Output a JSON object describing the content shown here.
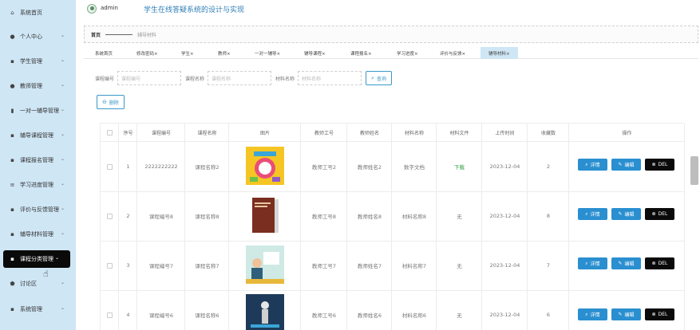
{
  "sidebar": {
    "items": [
      {
        "label": "系统首页",
        "icon": "home-icon",
        "glyph": "⌂",
        "arrow": ""
      },
      {
        "label": "个人中心",
        "icon": "person-icon",
        "glyph": "●",
        "arrow": "⌄"
      },
      {
        "label": "学生管理",
        "icon": "grid-icon",
        "glyph": "▪",
        "arrow": "⌄"
      },
      {
        "label": "教师管理",
        "icon": "bulb-icon",
        "glyph": "●",
        "arrow": "⌄"
      },
      {
        "label": "一对一辅导管理",
        "icon": "chart-icon",
        "glyph": "▮",
        "arrow": "⌄"
      },
      {
        "label": "辅导课程管理",
        "icon": "grid-icon",
        "glyph": "▪",
        "arrow": "⌄"
      },
      {
        "label": "课程报名管理",
        "icon": "doc-icon",
        "glyph": "▪",
        "arrow": "⌄"
      },
      {
        "label": "学习进度管理",
        "icon": "sliders-icon",
        "glyph": "≡",
        "arrow": "⌄"
      },
      {
        "label": "评价与反馈管理",
        "icon": "grid-icon",
        "glyph": "▪",
        "arrow": "⌄"
      },
      {
        "label": "辅导材料管理",
        "icon": "grid-icon",
        "glyph": "▪",
        "arrow": "⌄"
      },
      {
        "label": "课程分类管理",
        "icon": "grid-icon",
        "glyph": "▪",
        "arrow": "⌄"
      },
      {
        "label": "讨论区",
        "icon": "shield-icon",
        "glyph": "⬟",
        "arrow": "⌄"
      },
      {
        "label": "系统管理",
        "icon": "grid-icon",
        "glyph": "▪",
        "arrow": "⌄"
      }
    ]
  },
  "header": {
    "username": "admin",
    "title": "学生在线答疑系统的设计与实现"
  },
  "breadcrumb": {
    "home": "首页",
    "current": "辅导材料"
  },
  "tabs": [
    "系统首页",
    "修改密码×",
    "学生×",
    "教师×",
    "一对一辅导×",
    "辅导课程×",
    "课程报名×",
    "学习进度×",
    "评价与反馈×",
    "辅导材料×"
  ],
  "search": {
    "label1": "课程编号",
    "placeholder1": "课程编号",
    "label2": "课程名称",
    "placeholder2": "课程名称",
    "label3": "材料名称",
    "placeholder3": "材料名称",
    "button": "查询"
  },
  "actions": {
    "delete": "删除",
    "detail": "详情",
    "edit": "编辑",
    "del": "DEL"
  },
  "table": {
    "headers": [
      "序号",
      "课程编号",
      "课程名称",
      "图片",
      "教师工号",
      "教师姓名",
      "材料名称",
      "材料文件",
      "上传时间",
      "收藏数",
      "操作"
    ],
    "rows": [
      {
        "index": "1",
        "code": "2222222222",
        "name": "课程名称2",
        "image": "cover-image-1",
        "tid": "教师工号2",
        "tname": "教师姓名2",
        "material": "数字文档",
        "file": "下载",
        "time": "2023-12-04",
        "favs": "2"
      },
      {
        "index": "2",
        "code": "课程编号8",
        "name": "课程名称8",
        "image": "cover-image-2",
        "tid": "教师工号8",
        "tname": "教师姓名8",
        "material": "材料名称8",
        "file": "无",
        "time": "2023-12-04",
        "favs": "8"
      },
      {
        "index": "3",
        "code": "课程编号7",
        "name": "课程名称7",
        "image": "cover-image-3",
        "tid": "教师工号7",
        "tname": "教师姓名7",
        "material": "材料名称7",
        "file": "无",
        "time": "2023-12-04",
        "favs": "7"
      },
      {
        "index": "4",
        "code": "课程编号6",
        "name": "课程名称6",
        "image": "cover-image-4",
        "tid": "教师工号6",
        "tname": "教师姓名6",
        "material": "材料名称6",
        "file": "无",
        "time": "2023-12-04",
        "favs": "6"
      }
    ]
  },
  "colors": {
    "sidebar_bg": "#cfe6f5",
    "accent": "#2a8fd0",
    "title": "#2f7fb8",
    "active_bg": "#0a0a0a",
    "download": "#2e9e3e"
  }
}
